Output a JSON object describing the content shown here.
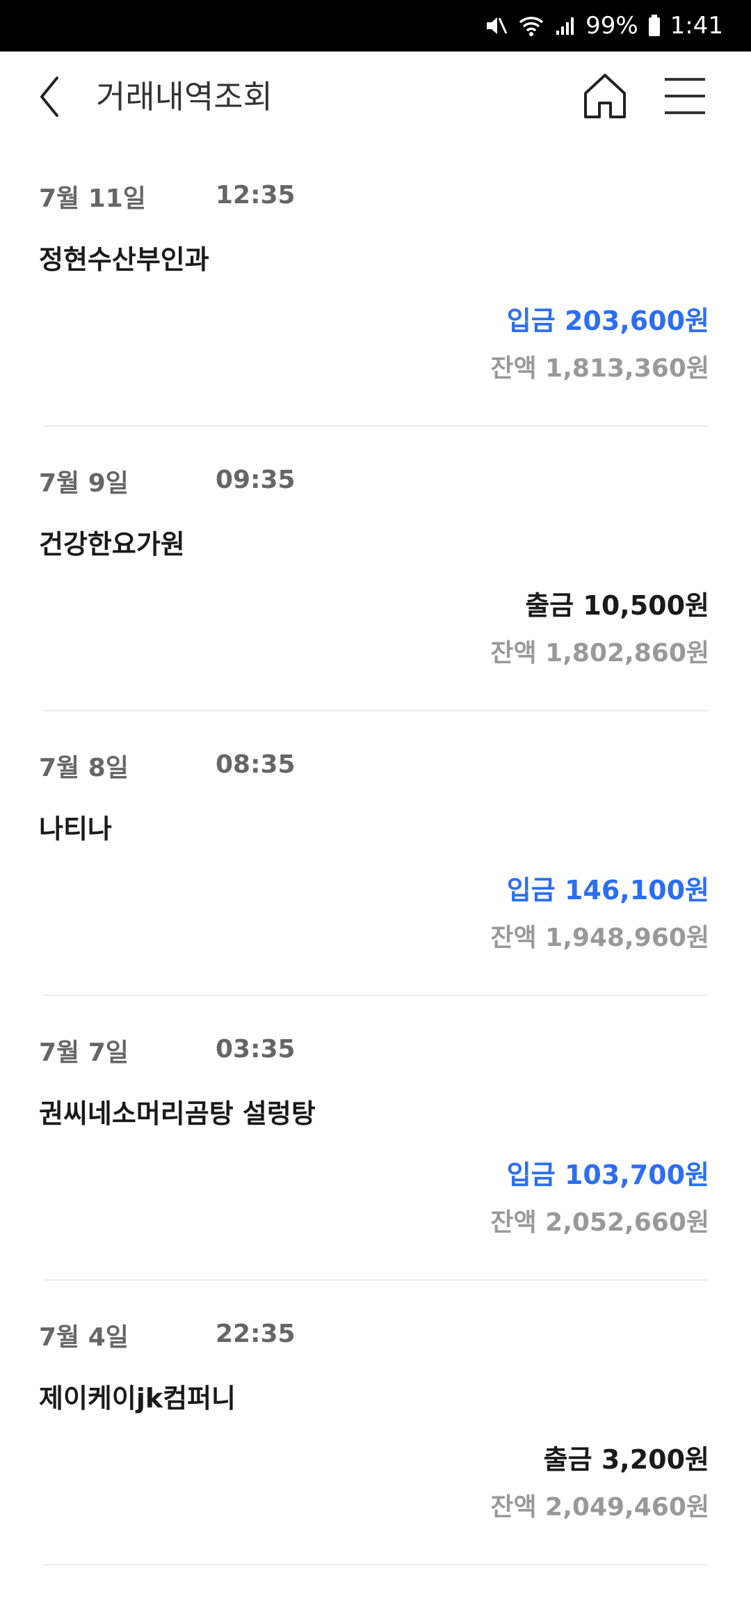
{
  "status_bar": {
    "battery": "99%",
    "time": "1:41"
  },
  "header": {
    "title": "거래내역조회"
  },
  "transactions": [
    {
      "date": "7월 11일",
      "time": "12:35",
      "merchant": "정현수산부인과",
      "type": "입금",
      "amount": "203,600원",
      "balance_label": "잔액",
      "balance": "1,813,360원"
    },
    {
      "date": "7월 9일",
      "time": "09:35",
      "merchant": "건강한요가원",
      "type": "출금",
      "amount": "10,500원",
      "balance_label": "잔액",
      "balance": "1,802,860원"
    },
    {
      "date": "7월 8일",
      "time": "08:35",
      "merchant": "나티나",
      "type": "입금",
      "amount": "146,100원",
      "balance_label": "잔액",
      "balance": "1,948,960원"
    },
    {
      "date": "7월 7일",
      "time": "03:35",
      "merchant": "권씨네소머리곰탕 설렁탕",
      "type": "입금",
      "amount": "103,700원",
      "balance_label": "잔액",
      "balance": "2,052,660원"
    },
    {
      "date": "7월 4일",
      "time": "22:35",
      "merchant": "제이케이jk컴퍼니",
      "type": "출금",
      "amount": "3,200원",
      "balance_label": "잔액",
      "balance": "2,049,460원"
    }
  ],
  "colors": {
    "deposit": "#2b6ef2",
    "withdrawal": "#1a1a1a",
    "balance": "#999999"
  },
  "icons": {
    "back": "back-arrow-icon",
    "home": "home-icon",
    "menu": "hamburger-menu-icon"
  }
}
